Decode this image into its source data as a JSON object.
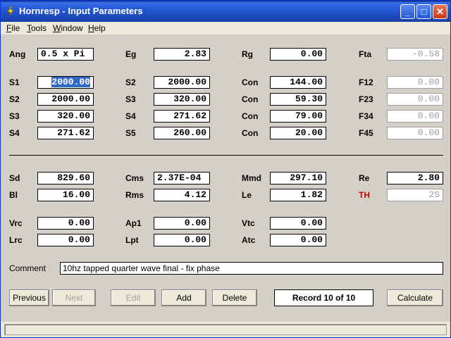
{
  "window": {
    "title": "Hornresp - Input Parameters",
    "buttons": {
      "minimize": "_",
      "maximize": "□",
      "close": "✕"
    }
  },
  "menu": [
    {
      "label_u": "F",
      "label_rest": "ile"
    },
    {
      "label_u": "T",
      "label_rest": "ools"
    },
    {
      "label_u": "W",
      "label_rest": "indow"
    },
    {
      "label_u": "H",
      "label_rest": "elp"
    }
  ],
  "params": {
    "ang": {
      "label": "Ang",
      "value": "0.5 x Pi"
    },
    "eg": {
      "label": "Eg",
      "value": "2.83"
    },
    "rg": {
      "label": "Rg",
      "value": "0.00"
    },
    "fta": {
      "label": "Fta",
      "value": "-0.58"
    },
    "s1a": {
      "label": "S1",
      "value": "2000.00"
    },
    "s2a": {
      "label": "S2",
      "value": "2000.00"
    },
    "con1": {
      "label": "Con",
      "value": "144.00"
    },
    "f12": {
      "label": "F12",
      "value": "0.00"
    },
    "s2b": {
      "label": "S2",
      "value": "2000.00"
    },
    "s3a": {
      "label": "S3",
      "value": "320.00"
    },
    "con2": {
      "label": "Con",
      "value": "59.30"
    },
    "f23": {
      "label": "F23",
      "value": "0.00"
    },
    "s3b": {
      "label": "S3",
      "value": "320.00"
    },
    "s4a": {
      "label": "S4",
      "value": "271.62"
    },
    "con3": {
      "label": "Con",
      "value": "79.00"
    },
    "f34": {
      "label": "F34",
      "value": "0.00"
    },
    "s4b": {
      "label": "S4",
      "value": "271.62"
    },
    "s5": {
      "label": "S5",
      "value": "260.00"
    },
    "con4": {
      "label": "Con",
      "value": "20.00"
    },
    "f45": {
      "label": "F45",
      "value": "0.00"
    },
    "sd": {
      "label": "Sd",
      "value": "829.60"
    },
    "cms": {
      "label": "Cms",
      "value": "2.37E-04"
    },
    "mmd": {
      "label": "Mmd",
      "value": "297.10"
    },
    "re": {
      "label": "Re",
      "value": "2.80"
    },
    "bl": {
      "label": "Bl",
      "value": "16.00"
    },
    "rms": {
      "label": "Rms",
      "value": "4.12"
    },
    "le": {
      "label": "Le",
      "value": "1.82"
    },
    "th": {
      "label": "TH",
      "value": "2S"
    },
    "vrc": {
      "label": "Vrc",
      "value": "0.00"
    },
    "ap1": {
      "label": "Ap1",
      "value": "0.00"
    },
    "vtc": {
      "label": "Vtc",
      "value": "0.00"
    },
    "lrc": {
      "label": "Lrc",
      "value": "0.00"
    },
    "lpt": {
      "label": "Lpt",
      "value": "0.00"
    },
    "atc": {
      "label": "Atc",
      "value": "0.00"
    }
  },
  "comment": {
    "label": "Comment",
    "value": "10hz tapped quarter wave final - fix phase"
  },
  "buttons": {
    "previous": "Previous",
    "next": "Next",
    "edit": "Edit",
    "add": "Add",
    "delete": "Delete",
    "calculate": "Calculate"
  },
  "record": "Record 10 of 10",
  "colors": {
    "title_bar": "#2458d8",
    "th_label": "#cc0000"
  }
}
